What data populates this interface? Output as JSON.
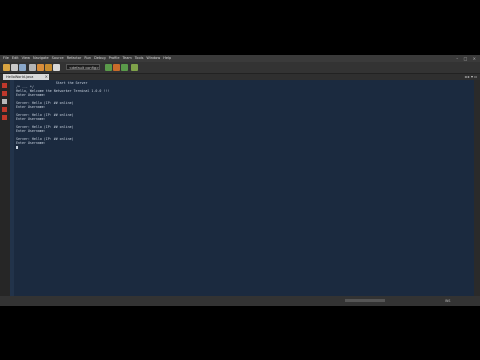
{
  "menu": [
    "File",
    "Edit",
    "View",
    "Navigate",
    "Source",
    "Refactor",
    "Run",
    "Debug",
    "Profile",
    "Team",
    "Tools",
    "Window",
    "Help"
  ],
  "window_controls": [
    "–",
    "□",
    "×"
  ],
  "toolbar": {
    "config_value": "<default config>",
    "button_colors": [
      "#d9a441",
      "#c9c9c9",
      "#8aa7c9",
      "#b5b5b5",
      "#d88d3a",
      "#c78b2e",
      "#d8d8d8",
      "#5a9a4a",
      "#c86b2a",
      "#5a9a4a",
      "#7fa24a"
    ]
  },
  "tabs": {
    "active_label": "HelloWorld.java",
    "close": "×"
  },
  "code_lines": [
    "                    Start the Server",
    "/* ... */",
    "Hello, Welcome the Networker Terminal 1.0.0 !!!",
    "Enter Username:",
    "",
    "Server: Hello (IP: ## online)",
    "Enter Username:",
    "",
    "Server: Hello (IP: ## online)",
    "Enter Username:",
    "",
    "Server: Hello (IP: ## online)",
    "Enter Username:",
    "",
    "Server: Hello (IP: ## online)",
    "Enter Username:"
  ],
  "status": {
    "left": "",
    "progress": "",
    "pos": "",
    "mode": "INS"
  }
}
